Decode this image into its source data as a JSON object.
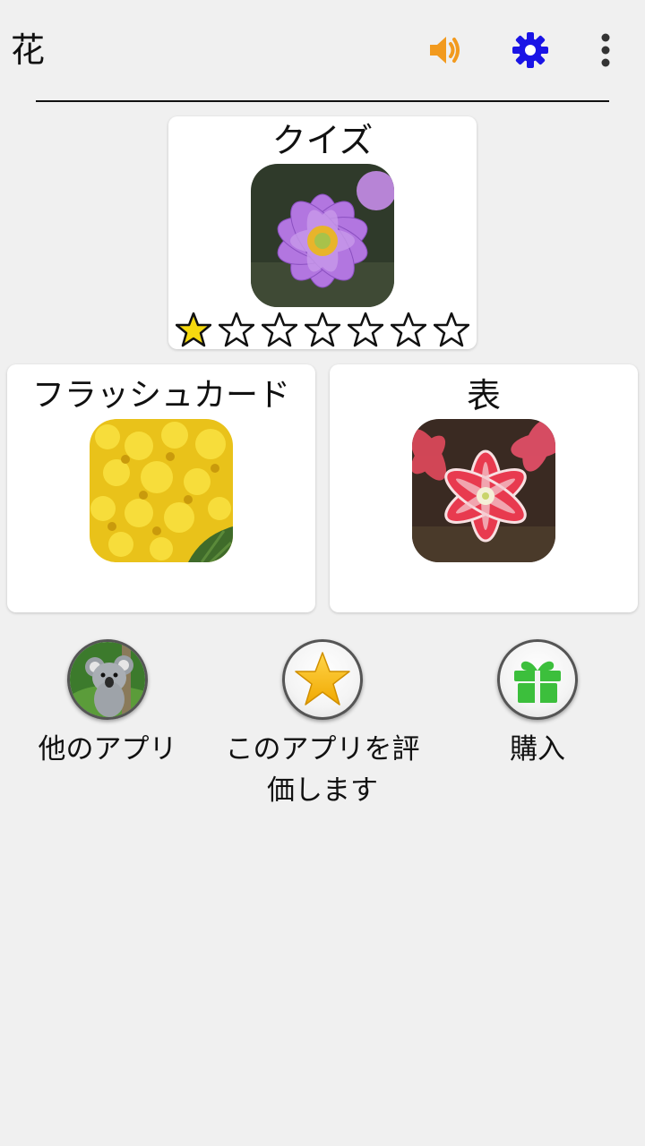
{
  "appbar": {
    "title": "花",
    "icons": {
      "sound": "speaker-icon",
      "settings": "gear-icon",
      "more": "more-vert-icon"
    },
    "colors": {
      "sound": "#f29a1e",
      "settings": "#1a14e6",
      "more": "#333333"
    }
  },
  "cards": {
    "quiz": {
      "title": "クイズ",
      "image": "anemone-flower-image",
      "stars_total": 7,
      "stars_filled": 1
    },
    "flashcards": {
      "title": "フラッシュカード",
      "image": "mimosa-flower-image"
    },
    "table": {
      "title": "表",
      "image": "amaryllis-flower-image"
    }
  },
  "actions": {
    "other_apps": {
      "label": "他のアプリ",
      "icon": "koala-image"
    },
    "rate": {
      "label": "このアプリを評価します",
      "icon": "star-icon"
    },
    "purchase": {
      "label": "購入",
      "icon": "gift-icon"
    }
  },
  "colors": {
    "background": "#f0f0f0",
    "star_fill": "#f5d90f",
    "gift": "#3cbf3c"
  }
}
